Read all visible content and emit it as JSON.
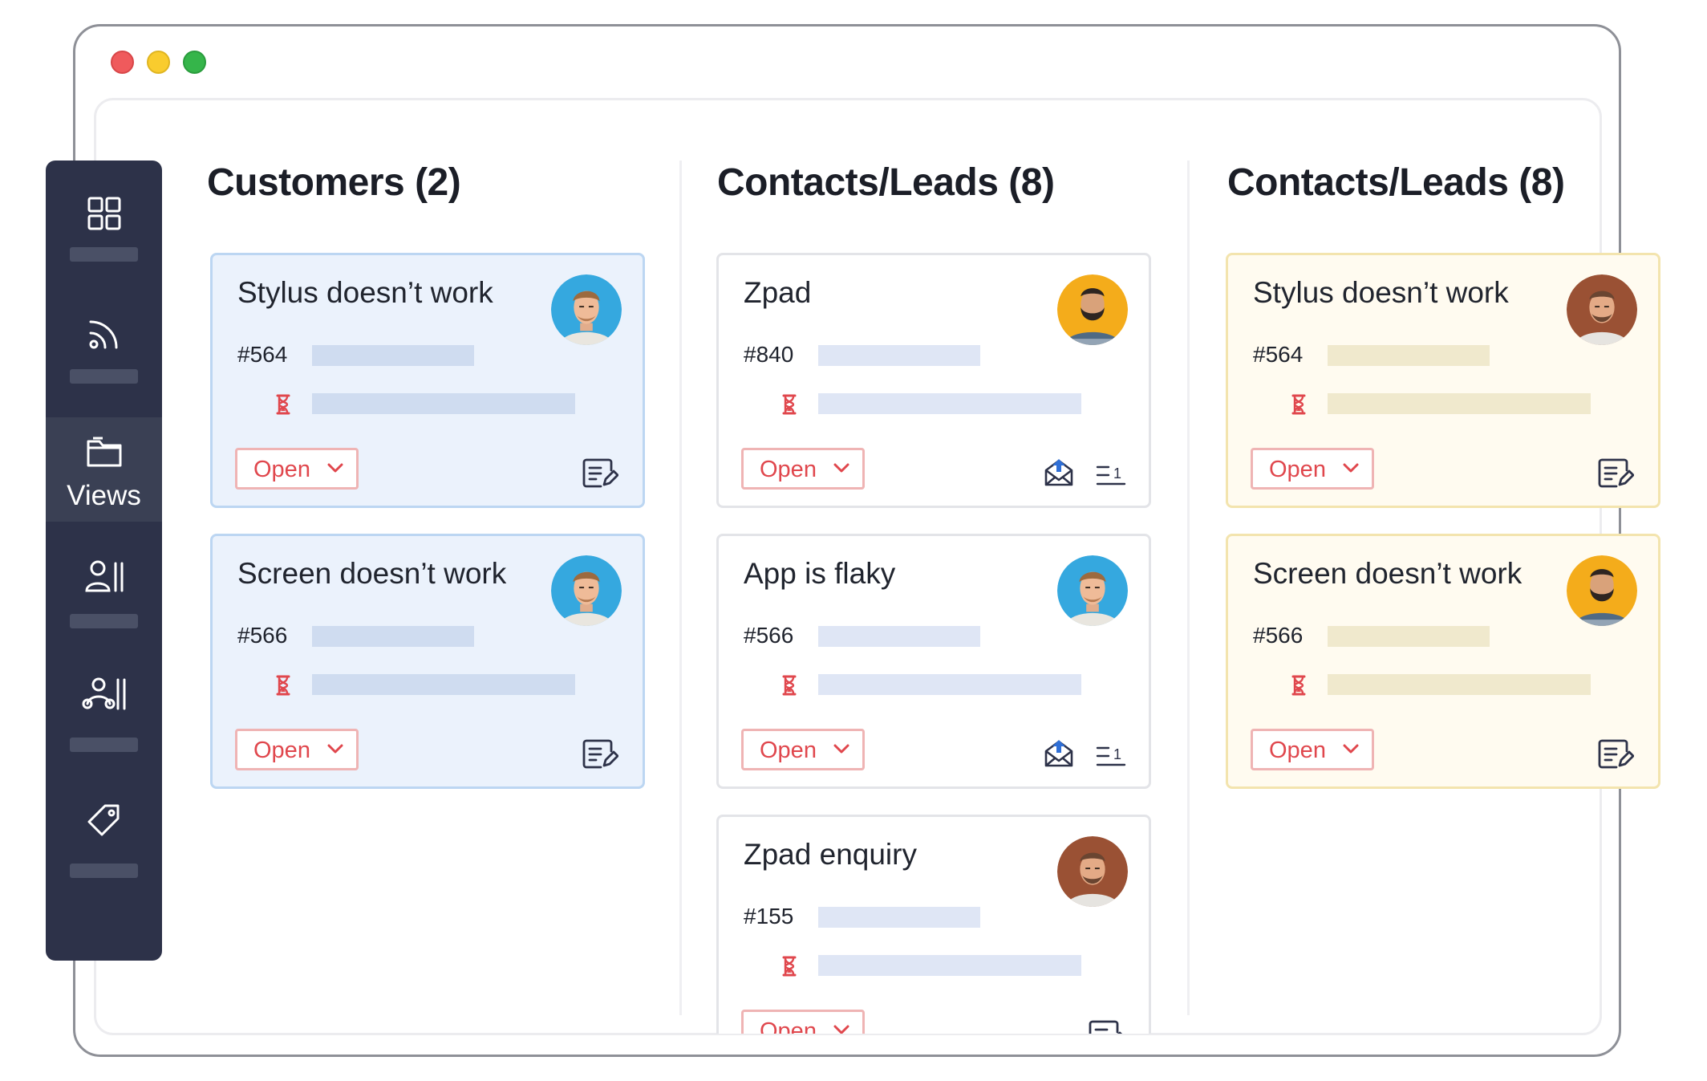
{
  "window": {
    "controls": [
      "close",
      "minimize",
      "maximize"
    ],
    "colors": [
      "#ef5a5c",
      "#f9cc2e",
      "#35b54a"
    ]
  },
  "sidebar": {
    "items": [
      {
        "icon": "dashboard-grid-icon",
        "label": ""
      },
      {
        "icon": "feed-icon",
        "label": ""
      },
      {
        "icon": "views-folder-icon",
        "label": "Views",
        "active": true
      },
      {
        "icon": "contacts-icon",
        "label": ""
      },
      {
        "icon": "accounts-icon",
        "label": ""
      },
      {
        "icon": "tag-icon",
        "label": ""
      }
    ]
  },
  "columns": [
    {
      "title": "Customers  (2)",
      "theme": "blue",
      "cards": [
        {
          "title": "Stylus doesn’t work",
          "id": "#564",
          "status": "Open",
          "avatar": "man-blue-bg",
          "actions": [
            "edit-note-icon"
          ]
        },
        {
          "title": "Screen doesn’t work",
          "id": "#566",
          "status": "Open",
          "avatar": "man-blue-bg",
          "actions": [
            "edit-note-icon"
          ]
        }
      ]
    },
    {
      "title": "Contacts/Leads (8)",
      "theme": "white",
      "cards": [
        {
          "title": "Zpad",
          "id": "#840",
          "status": "Open",
          "avatar": "bearded-man-yellow-bg",
          "actions": [
            "mail-icon",
            "thread-count-icon"
          ],
          "count": "1"
        },
        {
          "title": "App is flaky",
          "id": "#566",
          "status": "Open",
          "avatar": "man-blue-bg",
          "actions": [
            "mail-icon",
            "thread-count-icon"
          ],
          "count": "1"
        },
        {
          "title": "Zpad enquiry",
          "id": "#155",
          "status": "Open",
          "avatar": "man-brown-bg",
          "actions": [
            "edit-note-icon"
          ]
        }
      ]
    },
    {
      "title": "Contacts/Leads (8)",
      "theme": "yellow",
      "cards": [
        {
          "title": "Stylus doesn’t work",
          "id": "#564",
          "status": "Open",
          "avatar": "man-brown-bg",
          "actions": [
            "edit-note-icon"
          ]
        },
        {
          "title": "Screen doesn’t work",
          "id": "#566",
          "status": "Open",
          "avatar": "bearded-man-yellow-bg",
          "actions": [
            "edit-note-icon"
          ]
        }
      ]
    }
  ]
}
